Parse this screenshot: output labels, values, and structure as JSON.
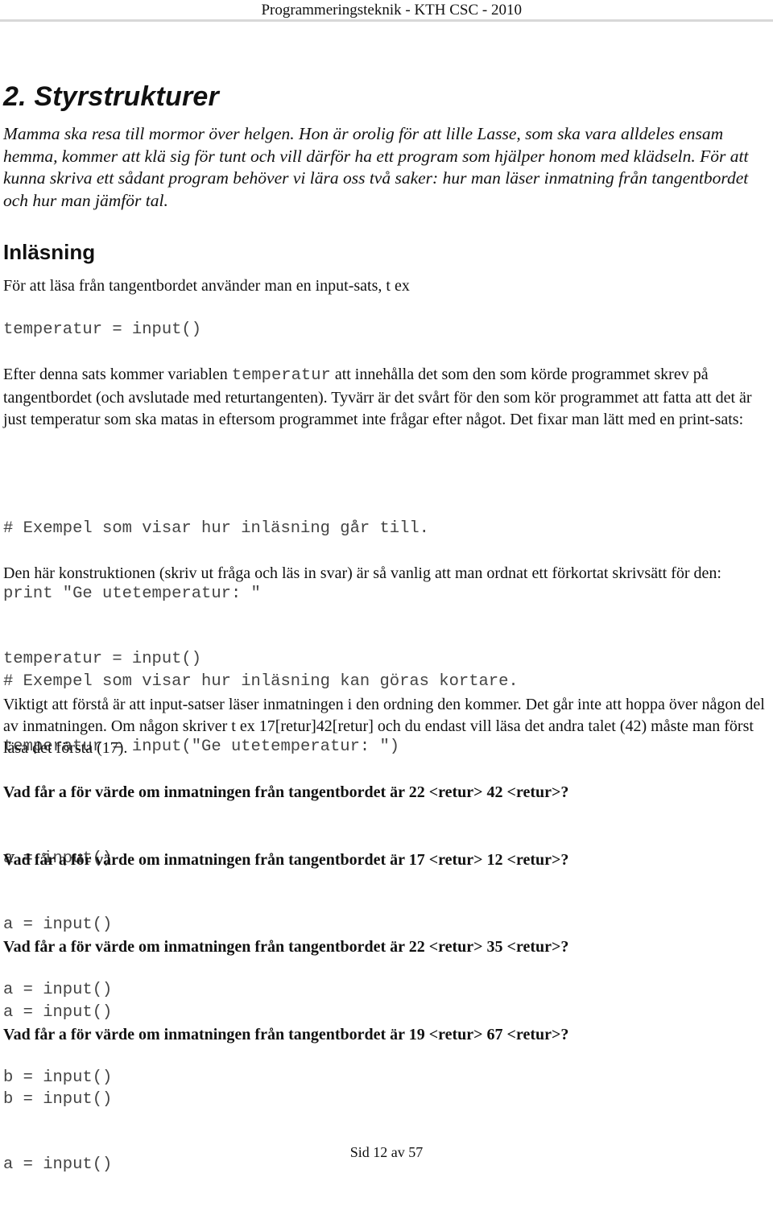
{
  "header": {
    "title": "Programmeringsteknik - KTH CSC - 2010"
  },
  "chapter": {
    "title": "2. Styrstrukturer",
    "intro": "Mamma ska resa till mormor över helgen. Hon är orolig för att lille Lasse, som ska vara alldeles ensam hemma, kommer att klä sig för tunt och vill därför ha ett program som hjälper honom med klädseln. För att kunna skriva ett sådant program behöver vi lära oss två saker: hur man läser inmatning från tangentbordet och hur man jämför tal."
  },
  "section": {
    "title": "Inläsning",
    "p1": "För att läsa från tangentbordet använder man en input-sats, t ex",
    "code1": "temperatur = input()",
    "p2_before": "Efter denna sats kommer variablen ",
    "p2_code": "temperatur",
    "p2_after": " att innehålla det som den som körde programmet skrev på tangentbordet (och avslutade med returtangenten). Tyvärr är det svårt för den som kör programmet att fatta att det är just temperatur som ska matas in eftersom programmet inte frågar efter något. Det fixar man lätt med en print-sats:",
    "code2": [
      "# Exempel som visar hur inläsning går till.",
      "print \"Ge utetemperatur: \"",
      "temperatur = input()"
    ],
    "p3": "Den här konstruktionen (skriv ut fråga och läs in svar) är så vanlig att man ordnat ett förkortat skrivsätt för den:",
    "code3": [
      "# Exempel som visar hur inläsning kan göras kortare.",
      "temperatur = input(\"Ge utetemperatur: \")"
    ],
    "p4": "Viktigt att förstå är att input-satser läser inmatningen i den ordning den kommer. Det går inte att hoppa över någon del av inmatningen. Om någon skriver t ex 17[retur]42[retur] och du endast vill läsa det andra talet (42) måste man först läsa det första (17).",
    "questions": [
      {
        "text": "Vad får a för värde om inmatningen från tangentbordet är 22 <retur> 42 <retur>?",
        "code": [
          "a = input()"
        ]
      },
      {
        "text": "Vad får a för värde om inmatningen från tangentbordet är 17 <retur> 12 <retur>?",
        "code": [
          "a = input()",
          "a = input()"
        ]
      },
      {
        "text": "Vad får a för värde om inmatningen från tangentbordet är 22 <retur> 35 <retur>?",
        "code": [
          "a = input()",
          "b = input()"
        ]
      },
      {
        "text": "Vad får a för värde om inmatningen från tangentbordet är 19 <retur> 67 <retur>?",
        "code": [
          "b = input()",
          "a = input()"
        ]
      }
    ]
  },
  "footer": {
    "page_label": "Sid 12 av 57"
  }
}
